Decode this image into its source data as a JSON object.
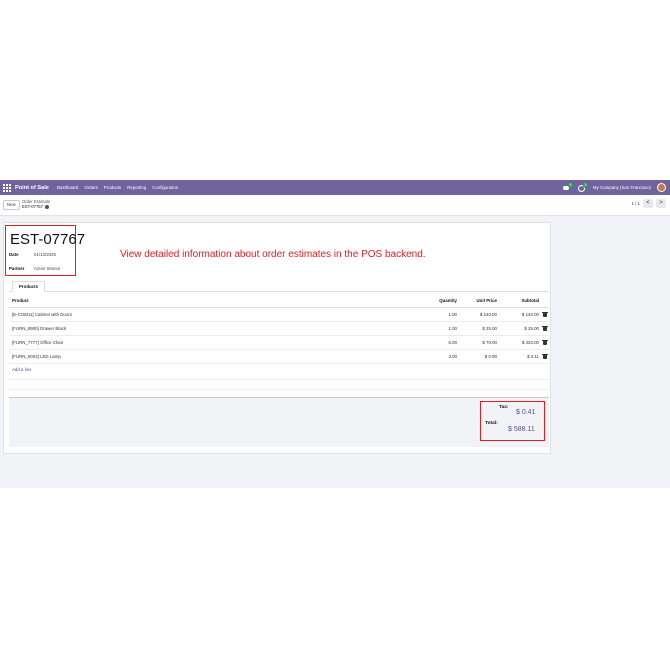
{
  "navbar": {
    "app_name": "Point of Sale",
    "menu": [
      "Dashboard",
      "Orders",
      "Products",
      "Reporting",
      "Configuration"
    ],
    "messages_badge": "5",
    "activity_badge": "3",
    "company": "My Company (San Francisco)"
  },
  "control": {
    "new_label": "New",
    "breadcrumb_parent": "Order Estimate",
    "breadcrumb_record": "EST-07767",
    "pager": "1 / 1",
    "prev": "<",
    "next": ">"
  },
  "form": {
    "title": "EST-07767",
    "date_label": "Date",
    "date_value": "01/13/2025",
    "partner_label": "Partner",
    "partner_value": "Azure Interior",
    "callout": "View detailed information about order estimates in the POS backend.",
    "tab_products": "Products",
    "columns": {
      "product": "Product",
      "quantity": "Quantity",
      "unit_price": "Unit Price",
      "subtotal": "Subtotal"
    },
    "lines": [
      {
        "product": "[E-COM11] Cabinet with Doors",
        "quantity": "1.00",
        "unit_price": "$ 140.00",
        "subtotal": "$ 140.00"
      },
      {
        "product": "[FURN_8900] Drawer Black",
        "quantity": "1.00",
        "unit_price": "$ 25.00",
        "subtotal": "$ 25.00"
      },
      {
        "product": "[FURN_7777] Office Chair",
        "quantity": "6.00",
        "unit_price": "$ 70.00",
        "subtotal": "$ 420.00"
      },
      {
        "product": "[FURN_0003] LED Lamp",
        "quantity": "3.00",
        "unit_price": "$ 0.90",
        "subtotal": "$ 3.11"
      }
    ],
    "add_line": "Add a line",
    "tax_label": "Tax:",
    "tax_value": "$ 0.41",
    "total_label": "Total:",
    "total_value": "$ 588.11"
  },
  "colors": {
    "navbar": "#71639e",
    "accent": "#5b4c91",
    "highlight": "#e02020"
  }
}
